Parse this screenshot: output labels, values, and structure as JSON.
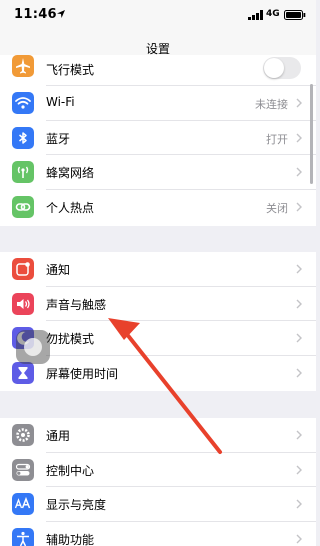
{
  "status_bar": {
    "time": "11:46",
    "network": "4G"
  },
  "nav": {
    "title": "设置"
  },
  "group1": {
    "airplane_label": "飞行模式",
    "wifi_label": "Wi-Fi",
    "wifi_value": "未连接",
    "bluetooth_label": "蓝牙",
    "bluetooth_value": "打开",
    "cellular_label": "蜂窝网络",
    "hotspot_label": "个人热点",
    "hotspot_value": "关闭"
  },
  "group2": {
    "notifications_label": "通知",
    "sounds_label": "声音与触感",
    "dnd_label": "勿扰模式",
    "screentime_label": "屏幕使用时间"
  },
  "group3": {
    "general_label": "通用",
    "control_center_label": "控制中心",
    "display_label": "显示与亮度",
    "accessibility_label": "辅助功能"
  },
  "colors": {
    "airplane": "#f19a37",
    "wifi": "#3478f6",
    "bluetooth": "#3478f6",
    "cellular": "#65c466",
    "hotspot": "#65c466",
    "notifications": "#eb4d3d",
    "sounds": "#eb445a",
    "dnd": "#5e5ce6",
    "screentime": "#5e5ce6",
    "general": "#8e8e93",
    "control_center": "#8e8e93",
    "display": "#3478f6",
    "accessibility": "#3478f6",
    "annotation_arrow": "#e8412c"
  },
  "icons": {
    "airplane": "airplane-icon",
    "wifi": "wifi-icon",
    "bluetooth": "bluetooth-icon",
    "cellular": "cellular-antenna-icon",
    "hotspot": "hotspot-link-icon",
    "notifications": "notification-icon",
    "sounds": "speaker-icon",
    "dnd": "moon-icon",
    "screentime": "hourglass-icon",
    "general": "gear-icon",
    "control_center": "switches-icon",
    "display": "text-size-icon",
    "accessibility": "accessibility-person-icon"
  }
}
